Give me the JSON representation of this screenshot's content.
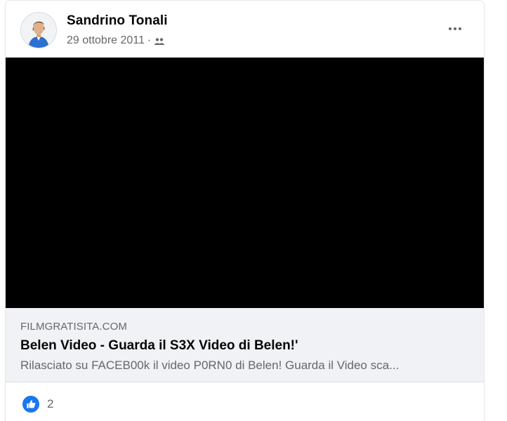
{
  "post": {
    "author": "Sandrino Tonali",
    "date": "29 ottobre 2011",
    "separator": "·",
    "audience_icon": "friends-icon",
    "more_icon": "more-options-icon"
  },
  "link_preview": {
    "domain": "FILMGRATISITA.COM",
    "title": "Belen Video - Guarda il S3X Video di Belen!'",
    "description": "Rilasciato su FACEB00k il video P0RN0 di Belen! Guarda il Video sca..."
  },
  "reactions": {
    "icon": "like-icon",
    "count": "2"
  },
  "colors": {
    "like_blue": "#1877f2",
    "video_bg": "#000000",
    "preview_bg": "#f0f2f5",
    "secondary_text": "#65676b"
  }
}
